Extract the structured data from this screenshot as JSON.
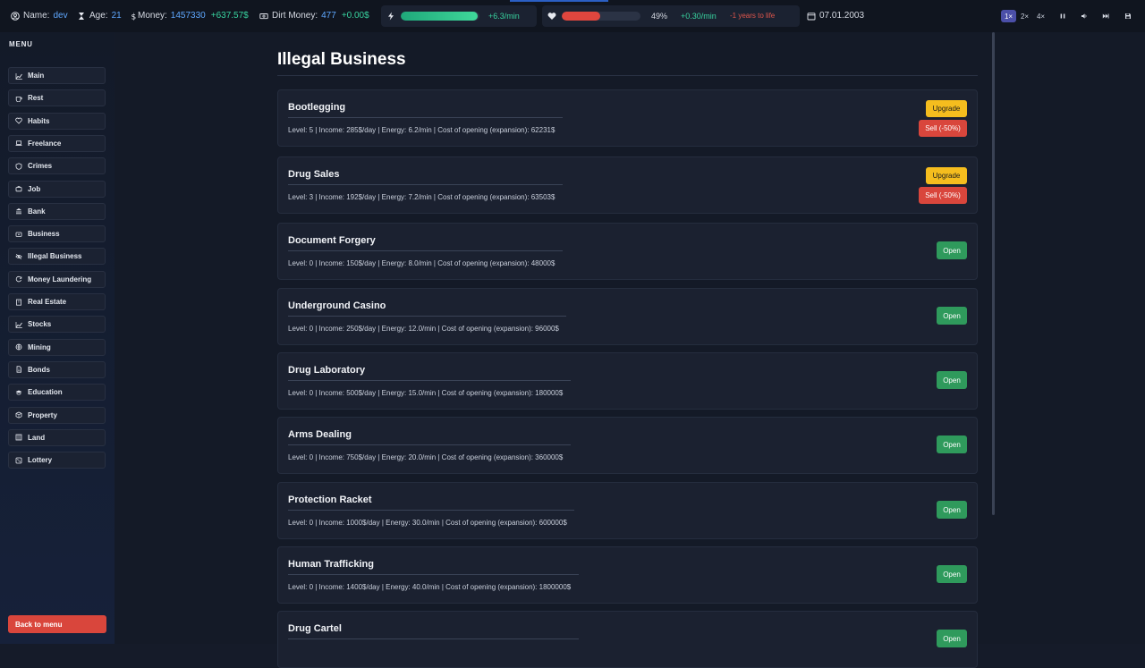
{
  "header": {
    "name_label": "Name:",
    "name_value": "dev",
    "age_label": "Age:",
    "age_value": "21",
    "money_label": "Money:",
    "money_value": "1457330",
    "money_delta": "+637.57$",
    "dirt_label": "Dirt Money:",
    "dirt_value": "477",
    "dirt_delta": "+0.00$",
    "energy_rate": "+6.3/min",
    "energy_level": 0.98,
    "health_percent": "49%",
    "health_level": 0.49,
    "health_rate": "+0.30/min",
    "life_change": "-1 years to life",
    "date": "07.01.2003",
    "speeds": [
      "1×",
      "2×",
      "4×"
    ],
    "colors": {
      "accent": "#5fa8ff",
      "positive": "#38d39f",
      "negative": "#e0564c",
      "energy": "#27c58a",
      "health": "#e0463e"
    }
  },
  "sidebar": {
    "title": "MENU",
    "items": [
      {
        "label": "Main",
        "icon": "chart-line-icon"
      },
      {
        "label": "Rest",
        "icon": "cup-icon"
      },
      {
        "label": "Habits",
        "icon": "heart-icon"
      },
      {
        "label": "Freelance",
        "icon": "laptop-icon"
      },
      {
        "label": "Crimes",
        "icon": "shield-icon"
      },
      {
        "label": "Job",
        "icon": "briefcase-icon"
      },
      {
        "label": "Bank",
        "icon": "bank-icon"
      },
      {
        "label": "Business",
        "icon": "wallet-icon"
      },
      {
        "label": "Illegal Business",
        "icon": "eye-slash-icon"
      },
      {
        "label": "Money Laundering",
        "icon": "refresh-icon"
      },
      {
        "label": "Real Estate",
        "icon": "building-icon"
      },
      {
        "label": "Stocks",
        "icon": "chart-line-icon"
      },
      {
        "label": "Mining",
        "icon": "globe-icon"
      },
      {
        "label": "Bonds",
        "icon": "document-icon"
      },
      {
        "label": "Education",
        "icon": "graduation-icon"
      },
      {
        "label": "Property",
        "icon": "box-icon"
      },
      {
        "label": "Land",
        "icon": "map-icon"
      },
      {
        "label": "Lottery",
        "icon": "dice-icon"
      }
    ],
    "back_label": "Back to menu"
  },
  "main": {
    "title": "Illegal Business",
    "businesses": [
      {
        "name": "Bootlegging",
        "info": "Level: 5 | Income: 285$/day | Energy: 6.2/min | Cost of opening (expansion): 62231$",
        "owned": true
      },
      {
        "name": "Drug Sales",
        "info": "Level: 3 | Income: 192$/day | Energy: 7.2/min | Cost of opening (expansion): 63503$",
        "owned": true
      },
      {
        "name": "Document Forgery",
        "info": "Level: 0 | Income: 150$/day | Energy: 8.0/min | Cost of opening (expansion): 48000$",
        "owned": false
      },
      {
        "name": "Underground Casino",
        "info": "Level: 0 | Income: 250$/day | Energy: 12.0/min | Cost of opening (expansion): 96000$",
        "owned": false
      },
      {
        "name": "Drug Laboratory",
        "info": "Level: 0 | Income: 500$/day | Energy: 15.0/min | Cost of opening (expansion): 180000$",
        "owned": false
      },
      {
        "name": "Arms Dealing",
        "info": "Level: 0 | Income: 750$/day | Energy: 20.0/min | Cost of opening (expansion): 360000$",
        "owned": false
      },
      {
        "name": "Protection Racket",
        "info": "Level: 0 | Income: 1000$/day | Energy: 30.0/min | Cost of opening (expansion): 600000$",
        "owned": false
      },
      {
        "name": "Human Trafficking",
        "info": "Level: 0 | Income: 1400$/day | Energy: 40.0/min | Cost of opening (expansion): 1800000$",
        "owned": false
      },
      {
        "name": "Drug Cartel",
        "info": "",
        "owned": false
      }
    ],
    "upgrade_label": "Upgrade",
    "sell_label": "Sell (-50%)",
    "open_label": "Open"
  }
}
